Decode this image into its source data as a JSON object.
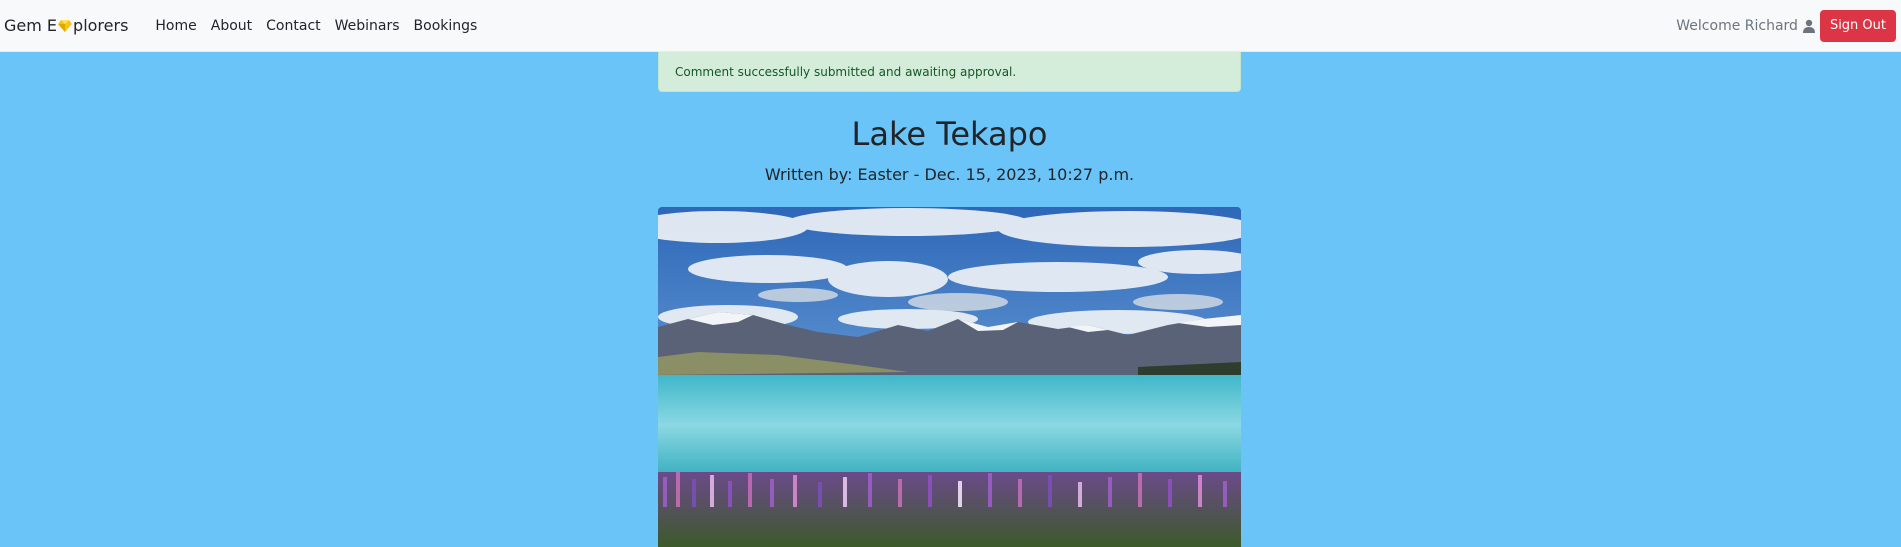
{
  "nav": {
    "brand_before": "Gem E",
    "brand_after": "plorers",
    "brand_icon": "gem-icon",
    "links": [
      "Home",
      "About",
      "Contact",
      "Webinars",
      "Bookings"
    ],
    "welcome": "Welcome Richard",
    "user_icon": "user-icon",
    "signout": "Sign Out"
  },
  "alert": {
    "message": "Comment successfully submitted and awaiting approval."
  },
  "post": {
    "title": "Lake Tekapo",
    "byline": "Written by: Easter - Dec. 15, 2023, 10:27 p.m."
  },
  "colors": {
    "page_bg": "#6ac4f8",
    "navbar_bg": "#f8f9fa",
    "signout_bg": "#dc3545",
    "alert_bg": "#d4edda",
    "alert_text": "#155724",
    "gem_yellow": "#f5c518"
  }
}
